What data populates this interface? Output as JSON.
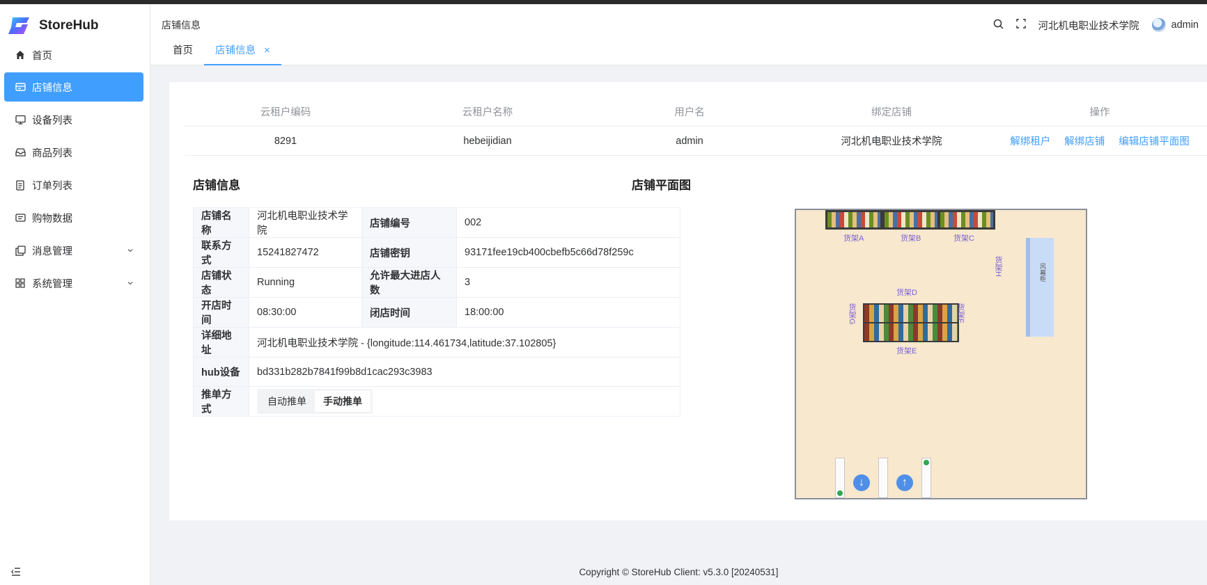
{
  "app": {
    "name": "StoreHub"
  },
  "sidebar": {
    "items": [
      {
        "label": "首页"
      },
      {
        "label": "店铺信息"
      },
      {
        "label": "设备列表"
      },
      {
        "label": "商品列表"
      },
      {
        "label": "订单列表"
      },
      {
        "label": "购物数据"
      },
      {
        "label": "消息管理"
      },
      {
        "label": "系统管理"
      }
    ]
  },
  "header": {
    "breadcrumb": "店铺信息",
    "store_name": "河北机电职业技术学院",
    "user": "admin",
    "tabs": [
      {
        "label": "首页"
      },
      {
        "label": "店铺信息"
      }
    ]
  },
  "tenant_table": {
    "headers": [
      "云租户编码",
      "云租户名称",
      "用户名",
      "绑定店铺",
      "操作"
    ],
    "row": {
      "code": "8291",
      "name": "hebeijidian",
      "username": "admin",
      "store": "河北机电职业技术学院",
      "actions": [
        "解绑租户",
        "解绑店铺",
        "编辑店铺平面图"
      ]
    }
  },
  "store_info": {
    "title": "店铺信息",
    "labels": {
      "name": "店铺名称",
      "number": "店铺编号",
      "contact": "联系方式",
      "secret": "店铺密钥",
      "status": "店铺状态",
      "max_people": "允许最大进店人数",
      "open": "开店时间",
      "close": "闭店时间",
      "address": "详细地址",
      "hub": "hub设备",
      "push": "推单方式"
    },
    "values": {
      "name": "河北机电职业技术学院",
      "number": "002",
      "contact": "15241827472",
      "secret": "93171fee19cb400cbefb5c66d78f259c",
      "status": "Running",
      "max_people": "3",
      "open": "08:30:00",
      "close": "18:00:00",
      "address": "河北机电职业技术学院 - {longitude:114.461734,latitude:37.102805}",
      "hub": "bd331b282b7841f99b8d1cac293c3983"
    },
    "push_options": [
      "自动推单",
      "手动推单"
    ],
    "push_selected": "手动推单"
  },
  "floor_plan": {
    "title": "店铺平面图",
    "shelves": {
      "a": "货架A",
      "b": "货架B",
      "c": "货架C",
      "d": "货架D",
      "e": "货架E",
      "f": "货架F",
      "g": "货架G",
      "h": "货架H",
      "cabinet": "风幕柜"
    },
    "colors": {
      "floor": "#f7e8ce",
      "label": "#7a5fd6",
      "cabinet": "#c9dcf7",
      "entry": "#4f8fe8"
    }
  },
  "footer": {
    "text": "Copyright © StoreHub Client: v5.3.0 [20240531]"
  },
  "colors": {
    "primary": "#409eff",
    "background": "#f0f2f5"
  }
}
